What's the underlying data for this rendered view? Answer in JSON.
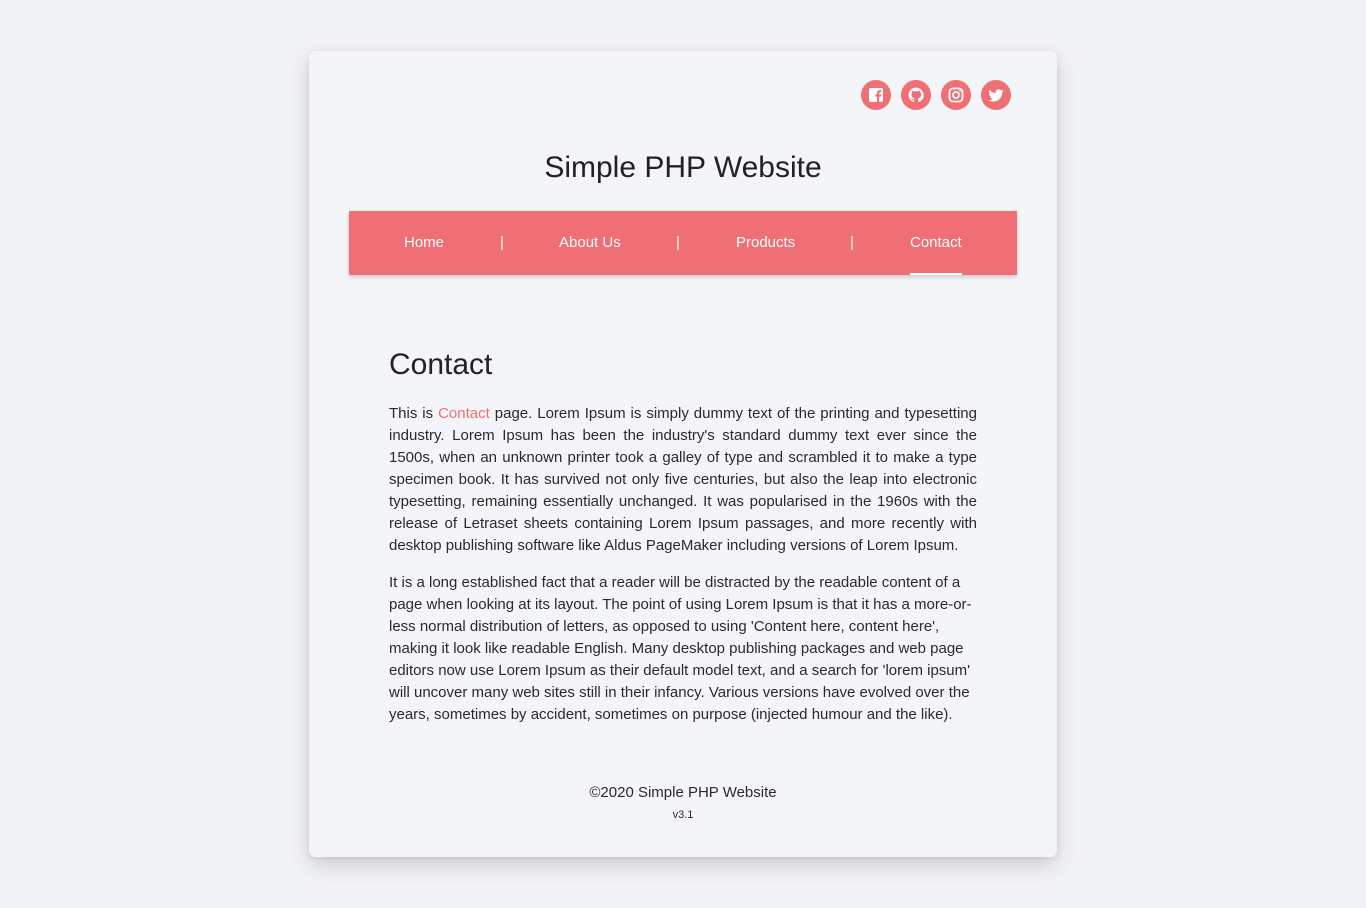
{
  "social": [
    {
      "name": "facebook",
      "icon": "facebook-icon"
    },
    {
      "name": "github",
      "icon": "github-icon"
    },
    {
      "name": "instagram",
      "icon": "instagram-icon"
    },
    {
      "name": "twitter",
      "icon": "twitter-icon"
    }
  ],
  "header": {
    "site_title": "Simple PHP Website"
  },
  "nav": {
    "items": [
      {
        "label": "Home",
        "active": false
      },
      {
        "label": "About Us",
        "active": false
      },
      {
        "label": "Products",
        "active": false
      },
      {
        "label": "Contact",
        "active": true
      }
    ],
    "separator": "|"
  },
  "main": {
    "heading": "Contact",
    "p1_prefix": "This is ",
    "p1_highlight": "Contact",
    "p1_suffix": " page. Lorem Ipsum is simply dummy text of the printing and typesetting industry. Lorem Ipsum has been the industry's standard dummy text ever since the 1500s, when an unknown printer took a galley of type and scrambled it to make a type specimen book. It has survived not only five centuries, but also the leap into electronic typesetting, remaining essentially unchanged. It was popularised in the 1960s with the release of Letraset sheets containing Lorem Ipsum passages, and more recently with desktop publishing software like Aldus PageMaker including versions of Lorem Ipsum.",
    "p2": "It is a long established fact that a reader will be distracted by the readable content of a page when looking at its layout. The point of using Lorem Ipsum is that it has a more-or-less normal distribution of letters, as opposed to using 'Content here, content here', making it look like readable English. Many desktop publishing packages and web page editors now use Lorem Ipsum as their default model text, and a search for 'lorem ipsum' will uncover many web sites still in their infancy. Various versions have evolved over the years, sometimes by accident, sometimes on purpose (injected humour and the like)."
  },
  "footer": {
    "copyright": "©2020 Simple PHP Website",
    "version": "v3.1"
  },
  "colors": {
    "accent": "#ef6f74",
    "background": "#f2f3f7",
    "card": "#f4f5f9",
    "text": "#222222"
  }
}
